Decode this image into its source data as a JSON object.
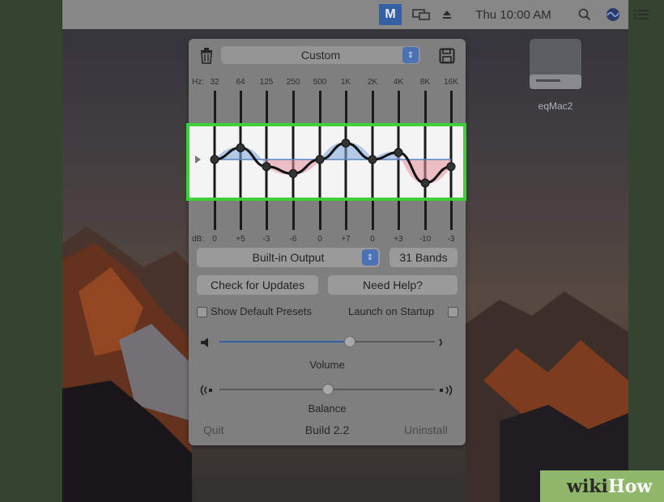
{
  "menubar": {
    "eq_icon_glyph": "M",
    "clock": "Thu 10:00 AM",
    "icons": [
      "eq-icon",
      "display-mirror-icon",
      "eject-icon",
      "search-icon",
      "siri-icon",
      "notification-list-icon"
    ]
  },
  "desktop": {
    "drive_label": "eqMac2"
  },
  "eq": {
    "preset": "Custom",
    "hz_prefix": "Hz:",
    "db_prefix": "dB:",
    "bands": [
      {
        "hz": "32",
        "db": "0"
      },
      {
        "hz": "64",
        "db": "+5"
      },
      {
        "hz": "125",
        "db": "-3"
      },
      {
        "hz": "250",
        "db": "-6"
      },
      {
        "hz": "500",
        "db": "0"
      },
      {
        "hz": "1K",
        "db": "+7"
      },
      {
        "hz": "2K",
        "db": "0"
      },
      {
        "hz": "4K",
        "db": "+3"
      },
      {
        "hz": "8K",
        "db": "-10"
      },
      {
        "hz": "16K",
        "db": "-3"
      }
    ],
    "output": "Built-in Output",
    "bands_button": "31 Bands",
    "check_updates": "Check for Updates",
    "need_help": "Need Help?",
    "show_presets": "Show Default Presets",
    "launch_startup": "Launch on Startup",
    "volume_label": "Volume",
    "balance_label": "Balance",
    "volume_level": 0.6,
    "balance_level": 0.5,
    "quit": "Quit",
    "build": "Build 2.2",
    "uninstall": "Uninstall"
  },
  "watermark": {
    "wiki": "wiki",
    "how": "How"
  },
  "colors": {
    "highlight_border": "#3ecf3a",
    "curve_positive": "#7ba7d8",
    "curve_negative": "#e88f9d",
    "menu_selected": "#3560a6"
  }
}
